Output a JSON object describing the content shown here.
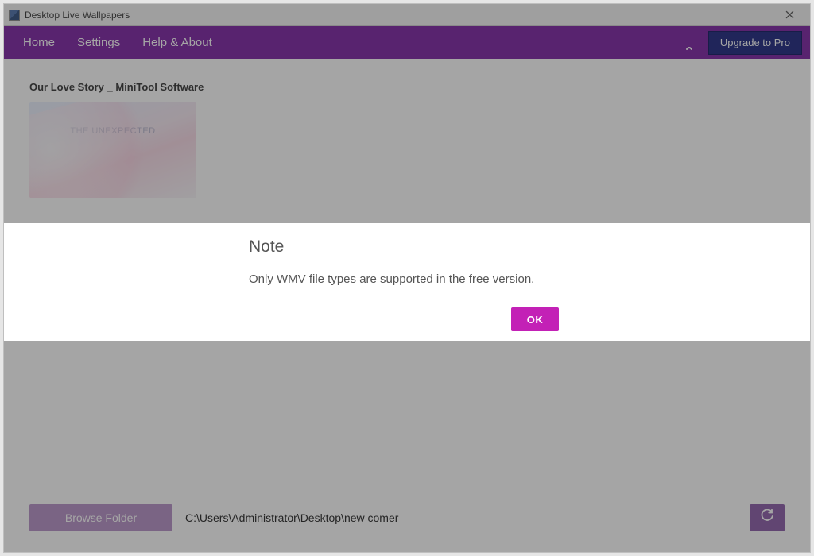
{
  "titlebar": {
    "app_name": "Desktop Live Wallpapers"
  },
  "menubar": {
    "tabs": [
      "Home",
      "Settings",
      "Help & About"
    ],
    "upgrade_label": "Upgrade to Pro"
  },
  "content": {
    "video_title": "Our Love Story _ MiniTool Software",
    "thumb_caption": "THE UNEXPECTED",
    "browse_label": "Browse Folder",
    "path_value": "C:\\Users\\Administrator\\Desktop\\new comer"
  },
  "modal": {
    "title": "Note",
    "message": "Only WMV file types are supported in the free version.",
    "ok_label": "OK"
  }
}
